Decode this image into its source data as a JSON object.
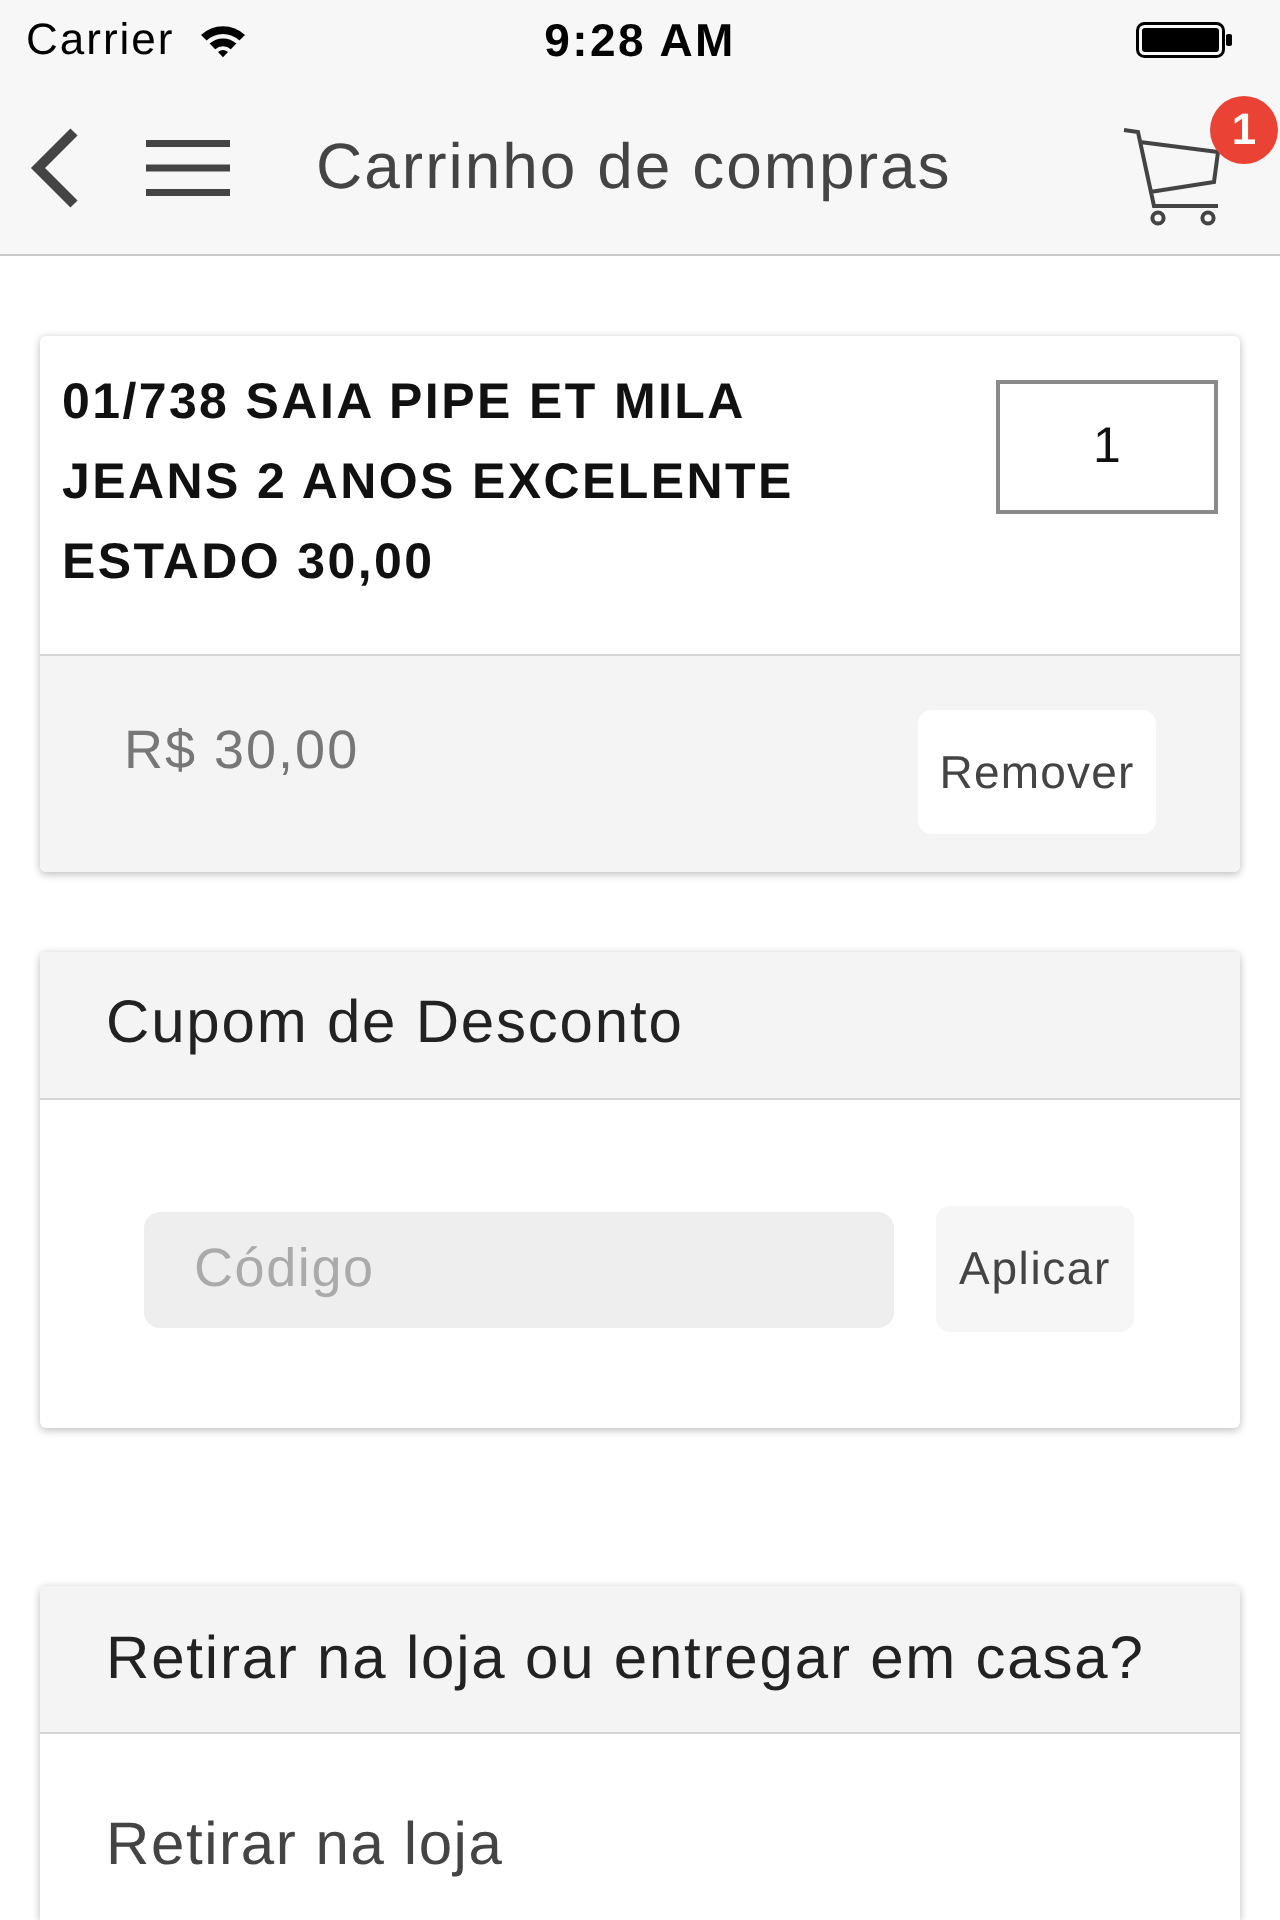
{
  "status_bar": {
    "carrier": "Carrier",
    "time": "9:28 AM"
  },
  "nav_bar": {
    "title": "Carrinho de compras",
    "cart_count": "1"
  },
  "cart_items": [
    {
      "description": "01/738 SAIA PIPE ET MILA JEANS 2 ANOS EXCELENTE ESTADO 30,00",
      "quantity": "1",
      "price": "R$ 30,00",
      "remove_button": "Remover"
    }
  ],
  "coupon": {
    "title": "Cupom de Desconto",
    "placeholder": "Código",
    "apply_button": "Aplicar"
  },
  "delivery": {
    "title": "Retirar na loja ou entregar em casa?",
    "options": [
      "Retirar na loja"
    ]
  }
}
